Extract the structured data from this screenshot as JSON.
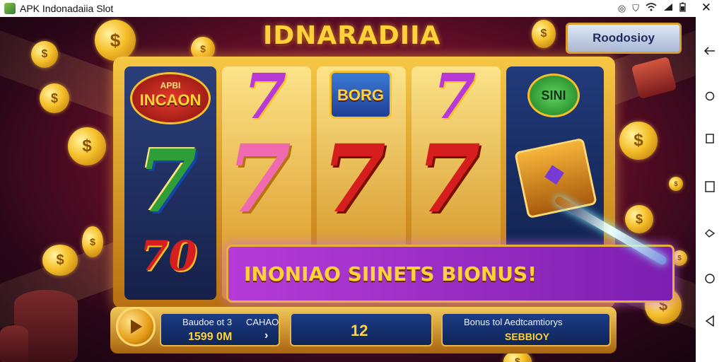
{
  "status_bar": {
    "title": "APK Indonadaiia Slot",
    "icons": [
      "location-icon",
      "shield-icon",
      "wifi-icon",
      "signal-icon",
      "battery-icon"
    ],
    "close_label": "✕"
  },
  "nav": {
    "buttons": [
      "back-arrow-icon",
      "circle-icon",
      "square-icon",
      "tall-square-icon",
      "rotate-icon",
      "circle-button-icon",
      "triangle-back-icon"
    ]
  },
  "game": {
    "logo": "IDNARADIIA",
    "top_button": "Roodosioy",
    "reels": {
      "r1_badge_top": "APBI",
      "r1_badge_main": "INCAON",
      "r3_badge": "BORG",
      "r5_badge": "SINI",
      "seven": "7",
      "seven_zero": "70"
    },
    "banner": "INONIAO SIINETS  BIONUS!",
    "bottom": {
      "spin_icon": "play-icon",
      "box1_label_a": "Baudoe ot 3",
      "box1_label_b": "CAHAO",
      "box1_value": "1599 0M",
      "box1_arrow": "›",
      "box2_value": "12",
      "box3_label": "Bonus tol Aedtcamtiorys",
      "box3_value": "SEBBIOY"
    }
  },
  "colors": {
    "accent_gold": "#ffd23a",
    "banner_purple": "#b63bd8",
    "panel_blue": "#1b3c86"
  }
}
